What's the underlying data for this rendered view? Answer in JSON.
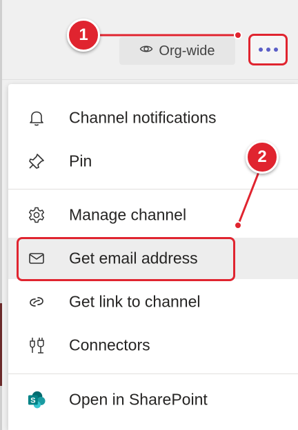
{
  "header": {
    "visibility_label": "Org-wide",
    "visibility_icon": "eye-icon",
    "more_icon": "more-options-icon"
  },
  "menu": {
    "items": [
      {
        "label": "Channel notifications",
        "icon": "bell-icon"
      },
      {
        "label": "Pin",
        "icon": "pin-icon"
      },
      {
        "label": "Manage channel",
        "icon": "gear-icon"
      },
      {
        "label": "Get email address",
        "icon": "mail-icon"
      },
      {
        "label": "Get link to channel",
        "icon": "link-icon"
      },
      {
        "label": "Connectors",
        "icon": "connectors-icon"
      },
      {
        "label": "Open in SharePoint",
        "icon": "sharepoint-icon"
      }
    ]
  },
  "callouts": {
    "one": "1",
    "two": "2"
  },
  "colors": {
    "annotation_red": "#e0242f",
    "teams_purple": "#5b5fc7",
    "sharepoint_teal": "#038387"
  }
}
